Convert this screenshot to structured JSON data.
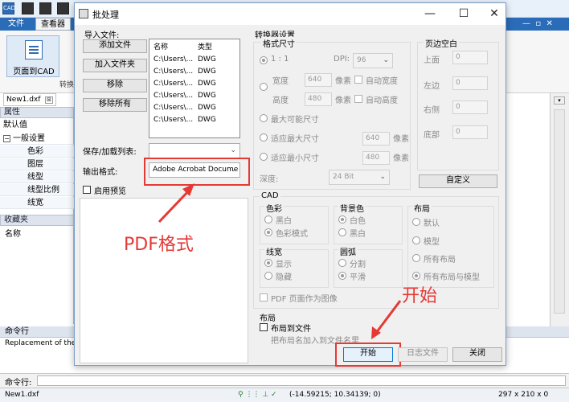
{
  "app": {
    "quick_icons": [
      "CAD",
      "",
      "",
      "",
      ""
    ],
    "menu": [
      "文件",
      "查看器"
    ],
    "ribbon_button": "页面到CAD",
    "ribbon_group": "转换",
    "doc_tab": "New1.dxf",
    "properties_header": "属性",
    "default_value": "默认值",
    "general_settings": "一般设置",
    "property_items": [
      "色彩",
      "图层",
      "线型",
      "线型比例",
      "线宽"
    ],
    "favorites_header": "收藏夹",
    "name_label": "名称",
    "command_header": "命令行",
    "command_output": "Replacement of the [C",
    "command_prompt": "命令行:",
    "status_file": "New1.dxf",
    "status_coords": "(-14.59215; 10.34139; 0)",
    "status_size": "297 x 210 x 0"
  },
  "dialog": {
    "title": "批处理",
    "import_files_label": "导入文件:",
    "add_file": "添加文件",
    "add_folder": "加入文件夹",
    "remove": "移除",
    "remove_all": "移除所有",
    "list_headers": [
      "名称",
      "类型"
    ],
    "files": [
      {
        "name": "C:\\Users\\...",
        "type": "DWG"
      },
      {
        "name": "C:\\Users\\...",
        "type": "DWG"
      },
      {
        "name": "C:\\Users\\...",
        "type": "DWG"
      },
      {
        "name": "C:\\Users\\...",
        "type": "DWG"
      },
      {
        "name": "C:\\Users\\...",
        "type": "DWG"
      },
      {
        "name": "C:\\Users\\...",
        "type": "DWG"
      }
    ],
    "save_load_list_label": "保存/加载列表:",
    "output_format_label": "输出格式:",
    "output_format_value": "Adobe Acrobat Docume",
    "enable_preview": "启用预览",
    "converter_settings": "转换器设置",
    "format_size": "格式尺寸",
    "ratio_1_1": "1 : 1",
    "dpi_label": "DPI:",
    "dpi_value": "96",
    "width_label": "宽度",
    "width_value": "640",
    "height_label": "高度",
    "height_value": "480",
    "pixels": "像素",
    "auto_width": "自动宽度",
    "auto_height": "自动高度",
    "max_possible_size": "最大可能尺寸",
    "fit_max_size": "适应最大尺寸",
    "fit_min_size": "适应最小尺寸",
    "fit_max_value": "640",
    "fit_min_value": "480",
    "depth_label": "深度:",
    "depth_value": "24 Bit",
    "margins_title": "页边空白",
    "margins": [
      {
        "label": "上面",
        "value": "0"
      },
      {
        "label": "左边",
        "value": "0"
      },
      {
        "label": "右侧",
        "value": "0"
      },
      {
        "label": "底部",
        "value": "0"
      }
    ],
    "customize": "自定义",
    "cad_title": "CAD",
    "color_title": "色彩",
    "color_options": [
      "黑白",
      "色彩模式"
    ],
    "background_title": "背景色",
    "background_options": [
      "白色",
      "黑白"
    ],
    "layout_title": "布局",
    "layout_options": [
      "默认",
      "模型",
      "所有布局",
      "所有布局与模型"
    ],
    "lineweight_title": "线宽",
    "lineweight_options": [
      "显示",
      "隐藏"
    ],
    "arc_title": "圆弧",
    "arc_options": [
      "分割",
      "平滑"
    ],
    "pdf_as_image": "PDF 页面作为图像",
    "layout_section_title": "布局",
    "layout_to_file": "布局到文件",
    "layout_name_suffix": "把布局名加入到文件名里",
    "start": "开始",
    "log_file": "日志文件",
    "close": "关闭"
  },
  "annotations": {
    "pdf_format": "PDF格式",
    "start": "开始",
    "color": "#e53935"
  }
}
